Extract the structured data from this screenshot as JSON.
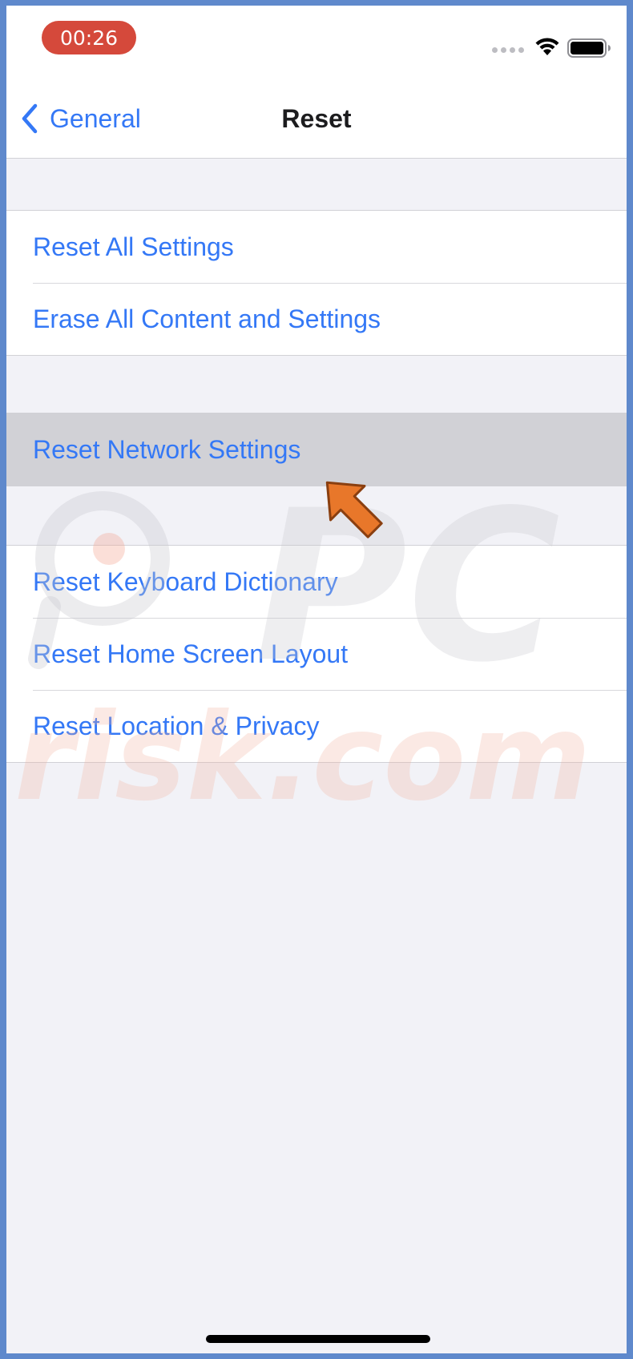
{
  "status_bar": {
    "time": "00:26",
    "recording_color": "#d5493b",
    "icons": [
      "signal-dots-icon",
      "wifi-icon",
      "battery-icon"
    ]
  },
  "nav": {
    "back_label": "General",
    "title": "Reset",
    "accent_color": "#3478f6"
  },
  "groups": [
    {
      "items": [
        {
          "label": "Reset All Settings"
        },
        {
          "label": "Erase All Content and Settings"
        }
      ]
    },
    {
      "items": [
        {
          "label": "Reset Network Settings",
          "highlighted": true
        }
      ]
    },
    {
      "items": [
        {
          "label": "Reset Keyboard Dictionary"
        },
        {
          "label": "Reset Home Screen Layout"
        },
        {
          "label": "Reset Location & Privacy"
        }
      ]
    }
  ],
  "overlay": {
    "pointer_arrow_color": "#e8772a",
    "watermark_text_1": "PC",
    "watermark_text_2": "risk.com"
  }
}
